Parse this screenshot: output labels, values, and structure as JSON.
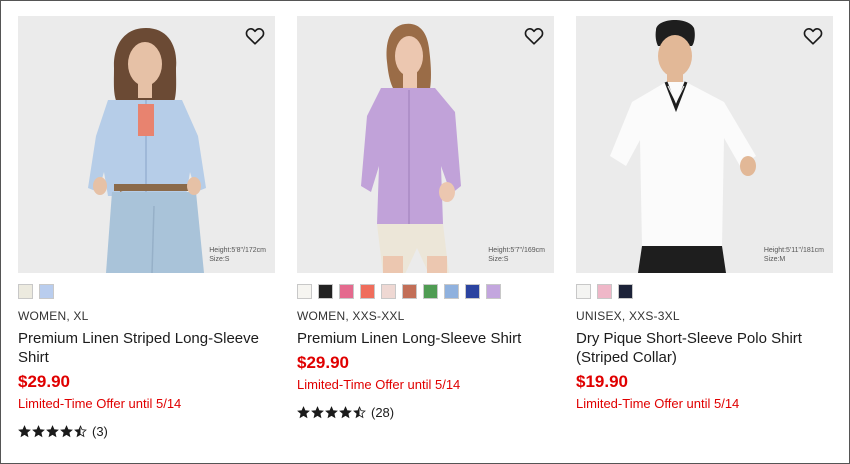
{
  "products": [
    {
      "meta": "WOMEN, XL",
      "name": "Premium Linen Striped Long-Sleeve Shirt",
      "price": "$29.90",
      "promo": "Limited-Time Offer until 5/14",
      "model_height": "Height:5'8\"/172cm",
      "model_size": "Size:S",
      "swatches": [
        "#eceadf",
        "#b9cdee"
      ],
      "rating": 4.5,
      "review_count": "(3)"
    },
    {
      "meta": "WOMEN, XXS-XXL",
      "name": "Premium Linen Long-Sleeve Shirt",
      "price": "$29.90",
      "promo": "Limited-Time Offer until 5/14",
      "model_height": "Height:5'7\"/169cm",
      "model_size": "Size:S",
      "swatches": [
        "#f6f5f1",
        "#222222",
        "#e46a8e",
        "#ef6d5c",
        "#efd8d3",
        "#c26e57",
        "#4f9c53",
        "#8fb1de",
        "#2b43a0",
        "#c3a6de"
      ],
      "rating": 4.5,
      "review_count": "(28)"
    },
    {
      "meta": "UNISEX, XXS-3XL",
      "name": "Dry Pique Short-Sleeve Polo Shirt (Striped Collar)",
      "price": "$19.90",
      "promo": "Limited-Time Offer until 5/14",
      "model_height": "Height:5'11\"/181cm",
      "model_size": "Size:M",
      "swatches": [
        "#f4f4f2",
        "#efb7c8",
        "#1c2238"
      ]
    }
  ],
  "icons": {
    "favorite": "heart-outline-icon",
    "star_full": "star-filled-icon",
    "star_half": "star-half-icon"
  },
  "colors": {
    "price": "#e00000",
    "image_bg": "#ebebeb"
  }
}
